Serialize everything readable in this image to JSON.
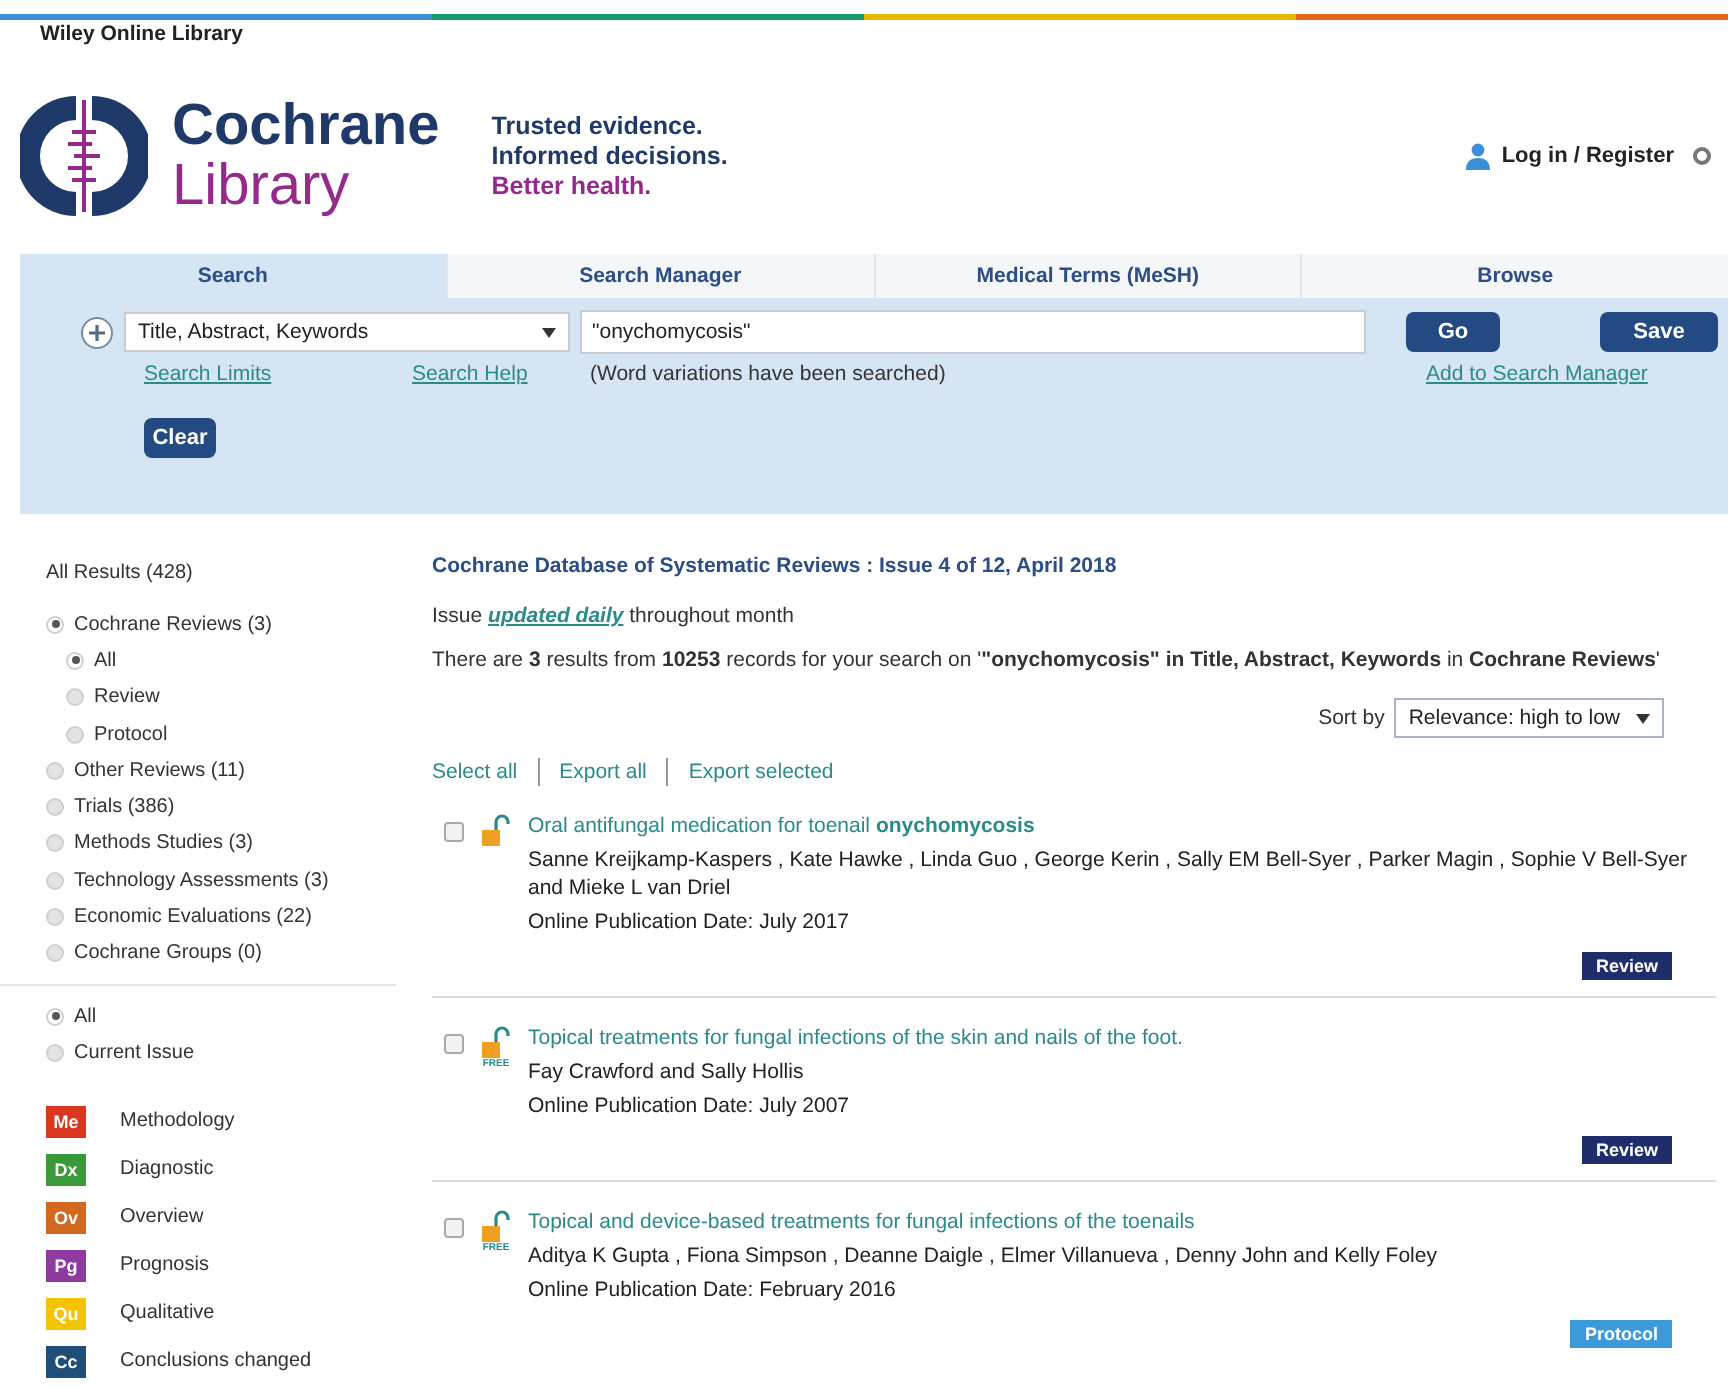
{
  "top_bar": {
    "brand": "Wiley Online Library"
  },
  "header": {
    "logo_top": "Cochrane",
    "logo_bottom": "Library",
    "tagline": [
      {
        "text": "Trusted evidence.",
        "accent": false
      },
      {
        "text": "Informed decisions.",
        "accent": false
      },
      {
        "text": "Better health.",
        "accent": true
      }
    ],
    "login": "Log in / Register"
  },
  "tabs": [
    {
      "label": "Search",
      "selected": true
    },
    {
      "label": "Search Manager",
      "selected": false
    },
    {
      "label": "Medical Terms (MeSH)",
      "selected": false
    },
    {
      "label": "Browse",
      "selected": false
    }
  ],
  "search": {
    "field_select": "Title, Abstract, Keywords",
    "query": "\"onychomycosis\"",
    "go": "Go",
    "save": "Save",
    "search_limits": "Search Limits",
    "search_help": "Search Help",
    "note": "(Word variations have been searched)",
    "add_manager": "Add to Search Manager",
    "clear": "Clear"
  },
  "sidebar": {
    "all_results": "All Results (428)",
    "databases": [
      {
        "label": "Cochrane Reviews (3)",
        "selected": true,
        "children": [
          {
            "label": "All",
            "selected": true
          },
          {
            "label": "Review",
            "selected": false
          },
          {
            "label": "Protocol",
            "selected": false
          }
        ]
      },
      {
        "label": "Other Reviews (11)",
        "selected": false
      },
      {
        "label": "Trials (386)",
        "selected": false
      },
      {
        "label": "Methods Studies (3)",
        "selected": false
      },
      {
        "label": "Technology Assessments (3)",
        "selected": false
      },
      {
        "label": "Economic Evaluations (22)",
        "selected": false
      },
      {
        "label": "Cochrane Groups (0)",
        "selected": false
      }
    ],
    "period": [
      {
        "label": "All",
        "selected": true
      },
      {
        "label": "Current Issue",
        "selected": false
      }
    ],
    "legend": [
      {
        "code": "Me",
        "label": "Methodology",
        "color": "#d9381e"
      },
      {
        "code": "Dx",
        "label": "Diagnostic",
        "color": "#3a9a3a"
      },
      {
        "code": "Ov",
        "label": "Overview",
        "color": "#d2691e"
      },
      {
        "code": "Pg",
        "label": "Prognosis",
        "color": "#8e3a9e"
      },
      {
        "code": "Qu",
        "label": "Qualitative",
        "color": "#f5c400"
      },
      {
        "code": "Cc",
        "label": "Conclusions changed",
        "color": "#1f4e79"
      }
    ]
  },
  "results": {
    "heading": "Cochrane Database of Systematic Reviews : Issue 4 of 12, April 2018",
    "issue_line": {
      "before": "Issue",
      "link": "updated daily",
      "after": "throughout month"
    },
    "summary": "There are **3** results from **10253** records for your search on '**\"onychomycosis\" in Title, Abstract, Keywords** in **Cochrane Reviews**'",
    "sort_label": "Sort by",
    "sort_value": "Relevance: high to low",
    "actions": [
      "Select all",
      "Export all",
      "Export selected"
    ],
    "items": [
      {
        "title": "Oral antifungal medication for toenail **onychomycosis**",
        "authors": "Sanne Kreijkamp-Kaspers , Kate Hawke , Linda Guo , George Kerin , Sally EM Bell-Syer , Parker Magin , Sophie V Bell-Syer and Mieke L van Driel",
        "date": "Online Publication Date: July 2017",
        "checked": false,
        "badge": {
          "kind": "review",
          "label": "Review"
        }
      },
      {
        "title": "Topical treatments for fungal infections of the skin and nails of the foot.",
        "authors": "Fay Crawford and Sally Hollis",
        "date": "Online Publication Date: July 2007",
        "free_label": "FREE",
        "checked": false,
        "badge": {
          "kind": "review",
          "label": "Review"
        }
      },
      {
        "title": "Topical and device-based treatments for fungal infections of the toenails",
        "authors": "Aditya K Gupta , Fiona Simpson , Deanne Daigle , Elmer Villanueva , Denny John and Kelly Foley",
        "date": "Online Publication Date: February 2016",
        "free_label": "FREE",
        "checked": false,
        "badge": {
          "kind": "protocol",
          "label": "Protocol"
        }
      }
    ]
  }
}
